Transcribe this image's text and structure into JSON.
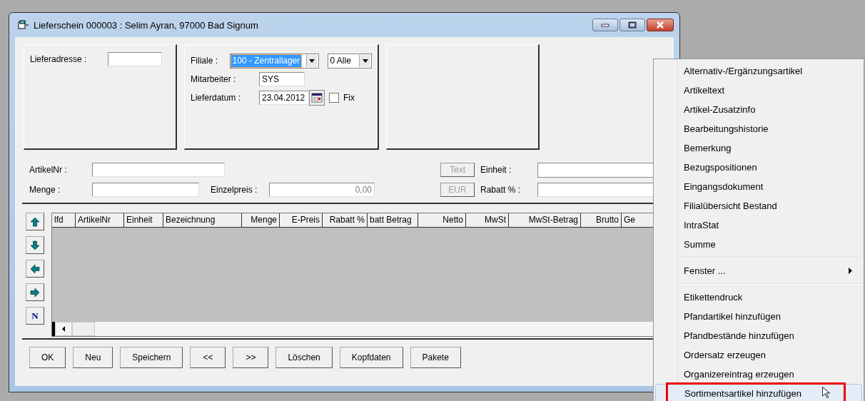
{
  "window": {
    "title": "Lieferschein 000003 : Selim Ayran, 97000 Bad Signum"
  },
  "header": {
    "lieferadresse": {
      "label": "Lieferadresse :"
    },
    "filiale": {
      "label": "Filiale :",
      "value": "100 - Zentrallager",
      "selected": true
    },
    "alle": {
      "value": "0 Alle"
    },
    "mitarbeiter": {
      "label": "Mitarbeiter :",
      "value": "SYS"
    },
    "lieferdatum": {
      "label": "Lieferdatum :",
      "value": "23.04.2012"
    },
    "fix": {
      "label": "Fix",
      "checked": false
    }
  },
  "article": {
    "artikelnr": {
      "label": "ArtikelNr :"
    },
    "menge": {
      "label": "Menge :"
    },
    "einzelpreis": {
      "label": "Einzelpreis :",
      "value": "0,00"
    },
    "text_button": {
      "label": "Text",
      "disabled": true
    },
    "einheit": {
      "label": "Einheit :"
    },
    "eur_button": {
      "label": "EUR",
      "disabled": true
    },
    "rabatt": {
      "label": "Rabatt % :"
    }
  },
  "grid": {
    "columns": [
      "lfd",
      "ArtikelNr",
      "Einheit",
      "Bezeichnung",
      "Menge",
      "E-Preis",
      "Rabatt %",
      "batt Betrag",
      "Netto",
      "MwSt",
      "MwSt-Betrag",
      "Brutto",
      "Ge"
    ],
    "nav_buttons": [
      {
        "kind": "up"
      },
      {
        "kind": "down"
      },
      {
        "kind": "left"
      },
      {
        "kind": "right"
      },
      {
        "kind": "letter",
        "label": "N"
      }
    ]
  },
  "buttons": [
    "OK",
    "Neu",
    "Speichern",
    "<<",
    ">>",
    "Löschen",
    "Kopfdaten",
    "Pakete"
  ],
  "context_menu": {
    "items": [
      {
        "kind": "item",
        "label": "Alternativ-/Ergänzungsartikel",
        "selected": false
      },
      {
        "kind": "item",
        "label": "Artikeltext",
        "selected": false
      },
      {
        "kind": "item",
        "label": "Artikel-Zusatzinfo",
        "selected": false
      },
      {
        "kind": "item",
        "label": "Bearbeitungshistorie",
        "selected": false
      },
      {
        "kind": "item",
        "label": "Bemerkung",
        "selected": false
      },
      {
        "kind": "item",
        "label": "Bezugspositionen",
        "selected": false
      },
      {
        "kind": "item",
        "label": "Eingangsdokument",
        "selected": false
      },
      {
        "kind": "item",
        "label": "Filialübersicht Bestand",
        "selected": false
      },
      {
        "kind": "item",
        "label": "IntraStat",
        "selected": false
      },
      {
        "kind": "item",
        "label": "Summe",
        "selected": false
      },
      {
        "kind": "separator"
      },
      {
        "kind": "submenu",
        "label": "Fenster ...",
        "selected": false
      },
      {
        "kind": "separator"
      },
      {
        "kind": "item",
        "label": "Etikettendruck",
        "selected": false
      },
      {
        "kind": "item",
        "label": "Pfandartikel hinzufügen",
        "selected": false
      },
      {
        "kind": "item",
        "label": "Pfandbestände hinzufügen",
        "selected": false
      },
      {
        "kind": "item",
        "label": "Ordersatz erzeugen",
        "selected": false
      },
      {
        "kind": "item",
        "label": "Organizereintrag erzeugen",
        "selected": false
      },
      {
        "kind": "item",
        "label": "Sortimentsartikel hinzufügen",
        "selected": true
      }
    ]
  }
}
